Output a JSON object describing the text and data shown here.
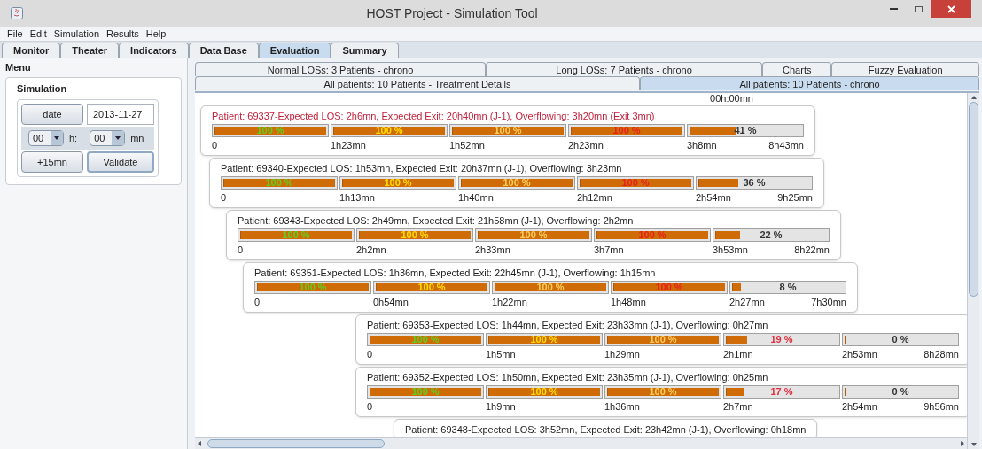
{
  "window": {
    "title": "HOST Project - Simulation Tool"
  },
  "menu_bar": [
    "File",
    "Edit",
    "Simulation",
    "Results",
    "Help"
  ],
  "tabs": [
    {
      "label": "Monitor",
      "selected": false
    },
    {
      "label": "Theater",
      "selected": false
    },
    {
      "label": "Indicators",
      "selected": false
    },
    {
      "label": "Data Base",
      "selected": false
    },
    {
      "label": "Evaluation",
      "selected": true
    },
    {
      "label": "Summary",
      "selected": false
    }
  ],
  "side_panel": {
    "title": "Menu",
    "group_title": "Simulation",
    "date_button": "date",
    "date_value": "2013-11-27",
    "hour": "00",
    "hour_unit": "h:",
    "minute": "00",
    "minute_unit": "mn",
    "add_button": "+15mn",
    "validate_button": "Validate"
  },
  "sub_tabs": [
    [
      {
        "label": "Normal LOSs: 3 Patients - chrono",
        "selected": false
      },
      {
        "label": "Long LOSs: 7 Patients - chrono",
        "selected": false
      },
      {
        "label": "Charts",
        "selected": false
      },
      {
        "label": "Fuzzy Evaluation",
        "selected": false
      }
    ],
    [
      {
        "label": "All patients: 10 Patients - Treatment Details",
        "selected": false
      },
      {
        "label": "All patients: 10 Patients - chrono",
        "selected": true
      }
    ]
  ],
  "timeline": {
    "start_label": "00h:00mn",
    "patients": [
      {
        "title": "Patient: 69337-Expected LOS: 2h6mn, Expected Exit: 20h40mn (J-1), Overflowing: 3h20mn (Exit 3mn)",
        "highlighted": true,
        "segments": [
          {
            "label": "100 %",
            "kind": "good",
            "level": 1,
            "tick": "0"
          },
          {
            "label": "100 %",
            "kind": "fair",
            "level": 1,
            "tick": "1h23mn"
          },
          {
            "label": "100 %",
            "kind": "warn",
            "level": 1,
            "tick": "1h52mn"
          },
          {
            "label": "100 %",
            "kind": "alert",
            "level": 1,
            "tick": "2h23mn"
          },
          {
            "label": "41 %",
            "kind": "neutral",
            "level": 0.41,
            "tick": "3h8mn"
          }
        ],
        "end_tick": "8h43mn"
      },
      {
        "title": "Patient: 69340-Expected LOS: 1h53mn, Expected Exit: 20h37mn (J-1), Overflowing: 3h23mn",
        "highlighted": false,
        "segments": [
          {
            "label": "100 %",
            "kind": "good",
            "level": 1,
            "tick": "0"
          },
          {
            "label": "100 %",
            "kind": "fair",
            "level": 1,
            "tick": "1h13mn"
          },
          {
            "label": "100 %",
            "kind": "warn",
            "level": 1,
            "tick": "1h40mn"
          },
          {
            "label": "100 %",
            "kind": "alert",
            "level": 1,
            "tick": "2h12mn"
          },
          {
            "label": "36 %",
            "kind": "neutral",
            "level": 0.36,
            "tick": "2h54mn"
          }
        ],
        "end_tick": "9h25mn"
      },
      {
        "title": "Patient: 69343-Expected LOS: 2h49mn, Expected Exit: 21h58mn (J-1), Overflowing: 2h2mn",
        "highlighted": false,
        "segments": [
          {
            "label": "100 %",
            "kind": "good",
            "level": 1,
            "tick": "0"
          },
          {
            "label": "100 %",
            "kind": "fair",
            "level": 1,
            "tick": "2h2mn"
          },
          {
            "label": "100 %",
            "kind": "warn",
            "level": 1,
            "tick": "2h33mn"
          },
          {
            "label": "100 %",
            "kind": "alert",
            "level": 1,
            "tick": "3h7mn"
          },
          {
            "label": "22 %",
            "kind": "neutral",
            "level": 0.22,
            "tick": "3h53mn"
          }
        ],
        "end_tick": "8h22mn"
      },
      {
        "title": "Patient: 69351-Expected LOS: 1h36mn, Expected Exit: 22h45mn (J-1), Overflowing: 1h15mn",
        "highlighted": false,
        "segments": [
          {
            "label": "100 %",
            "kind": "good",
            "level": 1,
            "tick": "0"
          },
          {
            "label": "100 %",
            "kind": "fair",
            "level": 1,
            "tick": "0h54mn"
          },
          {
            "label": "100 %",
            "kind": "warn",
            "level": 1,
            "tick": "1h22mn"
          },
          {
            "label": "100 %",
            "kind": "alert",
            "level": 1,
            "tick": "1h48mn"
          },
          {
            "label": "8 %",
            "kind": "neutral",
            "level": 0.08,
            "tick": "2h27mn"
          }
        ],
        "end_tick": "7h30mn"
      },
      {
        "title": "Patient: 69353-Expected LOS: 1h44mn, Expected Exit: 23h33mn (J-1), Overflowing: 0h27mn",
        "highlighted": false,
        "segments": [
          {
            "label": "100 %",
            "kind": "good",
            "level": 1,
            "tick": "0"
          },
          {
            "label": "100 %",
            "kind": "fair",
            "level": 1,
            "tick": "1h5mn"
          },
          {
            "label": "100 %",
            "kind": "warn",
            "level": 1,
            "tick": "1h29mn"
          },
          {
            "label": "19 %",
            "kind": "late",
            "level": 0.19,
            "tick": "2h1mn"
          },
          {
            "label": "0 %",
            "kind": "neutral",
            "level": 0,
            "tick": "2h53mn"
          }
        ],
        "end_tick": "8h28mn"
      },
      {
        "title": "Patient: 69352-Expected LOS: 1h50mn, Expected Exit: 23h35mn (J-1), Overflowing: 0h25mn",
        "highlighted": false,
        "segments": [
          {
            "label": "100 %",
            "kind": "good",
            "level": 1,
            "tick": "0"
          },
          {
            "label": "100 %",
            "kind": "fair",
            "level": 1,
            "tick": "1h9mn"
          },
          {
            "label": "100 %",
            "kind": "warn",
            "level": 1,
            "tick": "1h36mn"
          },
          {
            "label": "17 %",
            "kind": "late",
            "level": 0.17,
            "tick": "2h7mn"
          },
          {
            "label": "0 %",
            "kind": "neutral",
            "level": 0,
            "tick": "2h54mn"
          }
        ],
        "end_tick": "9h56mn"
      },
      {
        "title": "Patient: 69348-Expected LOS: 3h52mn, Expected Exit: 23h42mn (J-1), Overflowing: 0h18mn",
        "highlighted": false
      }
    ]
  }
}
